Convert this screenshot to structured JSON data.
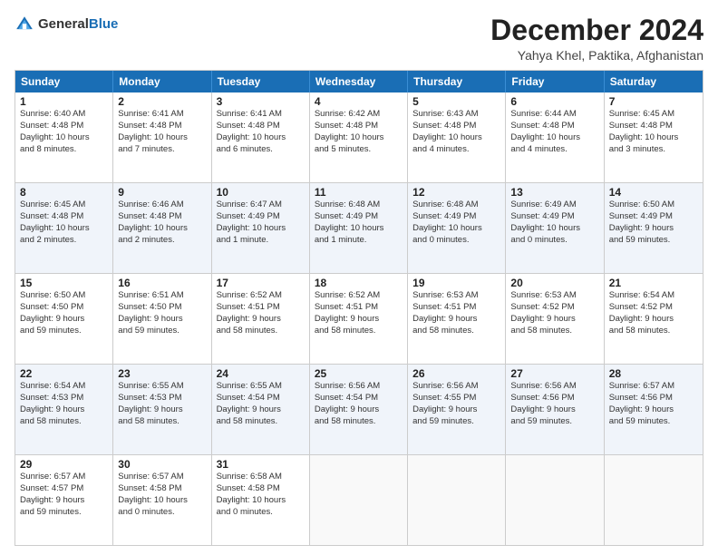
{
  "header": {
    "logo_general": "General",
    "logo_blue": "Blue",
    "month_title": "December 2024",
    "location": "Yahya Khel, Paktika, Afghanistan"
  },
  "calendar": {
    "headers": [
      "Sunday",
      "Monday",
      "Tuesday",
      "Wednesday",
      "Thursday",
      "Friday",
      "Saturday"
    ],
    "rows": [
      [
        {
          "day": "1",
          "lines": [
            "Sunrise: 6:40 AM",
            "Sunset: 4:48 PM",
            "Daylight: 10 hours",
            "and 8 minutes."
          ]
        },
        {
          "day": "2",
          "lines": [
            "Sunrise: 6:41 AM",
            "Sunset: 4:48 PM",
            "Daylight: 10 hours",
            "and 7 minutes."
          ]
        },
        {
          "day": "3",
          "lines": [
            "Sunrise: 6:41 AM",
            "Sunset: 4:48 PM",
            "Daylight: 10 hours",
            "and 6 minutes."
          ]
        },
        {
          "day": "4",
          "lines": [
            "Sunrise: 6:42 AM",
            "Sunset: 4:48 PM",
            "Daylight: 10 hours",
            "and 5 minutes."
          ]
        },
        {
          "day": "5",
          "lines": [
            "Sunrise: 6:43 AM",
            "Sunset: 4:48 PM",
            "Daylight: 10 hours",
            "and 4 minutes."
          ]
        },
        {
          "day": "6",
          "lines": [
            "Sunrise: 6:44 AM",
            "Sunset: 4:48 PM",
            "Daylight: 10 hours",
            "and 4 minutes."
          ]
        },
        {
          "day": "7",
          "lines": [
            "Sunrise: 6:45 AM",
            "Sunset: 4:48 PM",
            "Daylight: 10 hours",
            "and 3 minutes."
          ]
        }
      ],
      [
        {
          "day": "8",
          "lines": [
            "Sunrise: 6:45 AM",
            "Sunset: 4:48 PM",
            "Daylight: 10 hours",
            "and 2 minutes."
          ]
        },
        {
          "day": "9",
          "lines": [
            "Sunrise: 6:46 AM",
            "Sunset: 4:48 PM",
            "Daylight: 10 hours",
            "and 2 minutes."
          ]
        },
        {
          "day": "10",
          "lines": [
            "Sunrise: 6:47 AM",
            "Sunset: 4:49 PM",
            "Daylight: 10 hours",
            "and 1 minute."
          ]
        },
        {
          "day": "11",
          "lines": [
            "Sunrise: 6:48 AM",
            "Sunset: 4:49 PM",
            "Daylight: 10 hours",
            "and 1 minute."
          ]
        },
        {
          "day": "12",
          "lines": [
            "Sunrise: 6:48 AM",
            "Sunset: 4:49 PM",
            "Daylight: 10 hours",
            "and 0 minutes."
          ]
        },
        {
          "day": "13",
          "lines": [
            "Sunrise: 6:49 AM",
            "Sunset: 4:49 PM",
            "Daylight: 10 hours",
            "and 0 minutes."
          ]
        },
        {
          "day": "14",
          "lines": [
            "Sunrise: 6:50 AM",
            "Sunset: 4:49 PM",
            "Daylight: 9 hours",
            "and 59 minutes."
          ]
        }
      ],
      [
        {
          "day": "15",
          "lines": [
            "Sunrise: 6:50 AM",
            "Sunset: 4:50 PM",
            "Daylight: 9 hours",
            "and 59 minutes."
          ]
        },
        {
          "day": "16",
          "lines": [
            "Sunrise: 6:51 AM",
            "Sunset: 4:50 PM",
            "Daylight: 9 hours",
            "and 59 minutes."
          ]
        },
        {
          "day": "17",
          "lines": [
            "Sunrise: 6:52 AM",
            "Sunset: 4:51 PM",
            "Daylight: 9 hours",
            "and 58 minutes."
          ]
        },
        {
          "day": "18",
          "lines": [
            "Sunrise: 6:52 AM",
            "Sunset: 4:51 PM",
            "Daylight: 9 hours",
            "and 58 minutes."
          ]
        },
        {
          "day": "19",
          "lines": [
            "Sunrise: 6:53 AM",
            "Sunset: 4:51 PM",
            "Daylight: 9 hours",
            "and 58 minutes."
          ]
        },
        {
          "day": "20",
          "lines": [
            "Sunrise: 6:53 AM",
            "Sunset: 4:52 PM",
            "Daylight: 9 hours",
            "and 58 minutes."
          ]
        },
        {
          "day": "21",
          "lines": [
            "Sunrise: 6:54 AM",
            "Sunset: 4:52 PM",
            "Daylight: 9 hours",
            "and 58 minutes."
          ]
        }
      ],
      [
        {
          "day": "22",
          "lines": [
            "Sunrise: 6:54 AM",
            "Sunset: 4:53 PM",
            "Daylight: 9 hours",
            "and 58 minutes."
          ]
        },
        {
          "day": "23",
          "lines": [
            "Sunrise: 6:55 AM",
            "Sunset: 4:53 PM",
            "Daylight: 9 hours",
            "and 58 minutes."
          ]
        },
        {
          "day": "24",
          "lines": [
            "Sunrise: 6:55 AM",
            "Sunset: 4:54 PM",
            "Daylight: 9 hours",
            "and 58 minutes."
          ]
        },
        {
          "day": "25",
          "lines": [
            "Sunrise: 6:56 AM",
            "Sunset: 4:54 PM",
            "Daylight: 9 hours",
            "and 58 minutes."
          ]
        },
        {
          "day": "26",
          "lines": [
            "Sunrise: 6:56 AM",
            "Sunset: 4:55 PM",
            "Daylight: 9 hours",
            "and 59 minutes."
          ]
        },
        {
          "day": "27",
          "lines": [
            "Sunrise: 6:56 AM",
            "Sunset: 4:56 PM",
            "Daylight: 9 hours",
            "and 59 minutes."
          ]
        },
        {
          "day": "28",
          "lines": [
            "Sunrise: 6:57 AM",
            "Sunset: 4:56 PM",
            "Daylight: 9 hours",
            "and 59 minutes."
          ]
        }
      ],
      [
        {
          "day": "29",
          "lines": [
            "Sunrise: 6:57 AM",
            "Sunset: 4:57 PM",
            "Daylight: 9 hours",
            "and 59 minutes."
          ]
        },
        {
          "day": "30",
          "lines": [
            "Sunrise: 6:57 AM",
            "Sunset: 4:58 PM",
            "Daylight: 10 hours",
            "and 0 minutes."
          ]
        },
        {
          "day": "31",
          "lines": [
            "Sunrise: 6:58 AM",
            "Sunset: 4:58 PM",
            "Daylight: 10 hours",
            "and 0 minutes."
          ]
        },
        null,
        null,
        null,
        null
      ]
    ]
  }
}
